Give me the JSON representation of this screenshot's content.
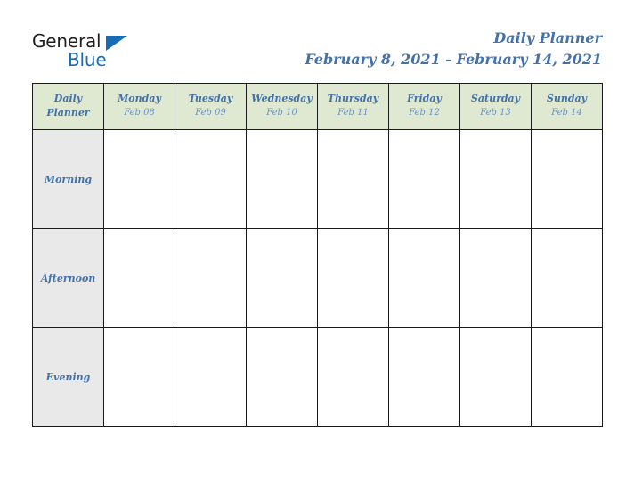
{
  "brand": {
    "name_part1": "General",
    "name_part2": "Blue",
    "logo_icon": "blue-triangle"
  },
  "header": {
    "title": "Daily Planner",
    "date_range": "February 8, 2021 - February 14, 2021"
  },
  "colors": {
    "accent_blue": "#4472a8",
    "logo_blue": "#1a6bb5",
    "header_green": "#dfe9d2",
    "period_gray": "#e9e9e9",
    "border": "#1a1a1a",
    "date_blue": "#6c92bf"
  },
  "table": {
    "corner": {
      "line1": "Daily",
      "line2": "Planner"
    },
    "days": [
      {
        "name": "Monday",
        "date": "Feb 08"
      },
      {
        "name": "Tuesday",
        "date": "Feb 09"
      },
      {
        "name": "Wednesday",
        "date": "Feb 10"
      },
      {
        "name": "Thursday",
        "date": "Feb 11"
      },
      {
        "name": "Friday",
        "date": "Feb 12"
      },
      {
        "name": "Saturday",
        "date": "Feb 13"
      },
      {
        "name": "Sunday",
        "date": "Feb 14"
      }
    ],
    "periods": [
      {
        "label": "Morning",
        "entries": [
          "",
          "",
          "",
          "",
          "",
          "",
          ""
        ]
      },
      {
        "label": "Afternoon",
        "entries": [
          "",
          "",
          "",
          "",
          "",
          "",
          ""
        ]
      },
      {
        "label": "Evening",
        "entries": [
          "",
          "",
          "",
          "",
          "",
          "",
          ""
        ]
      }
    ]
  }
}
